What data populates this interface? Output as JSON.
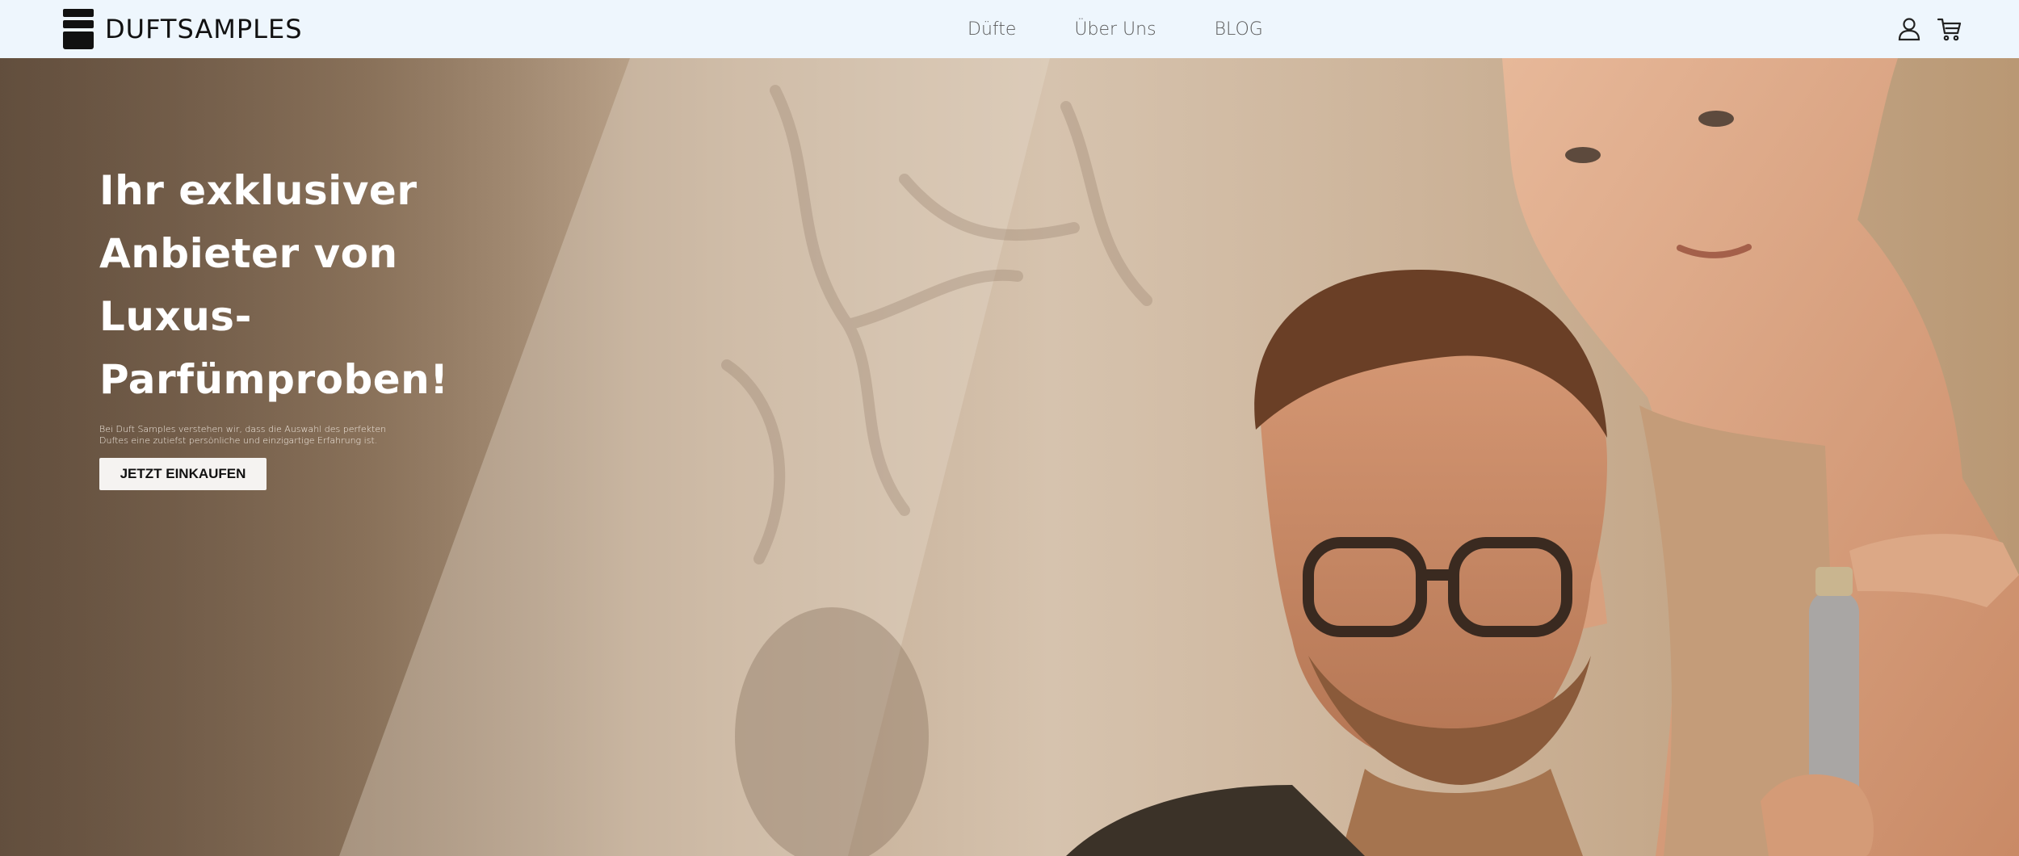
{
  "header": {
    "logo_text": "DUFTSAMPLES",
    "logo_icon": "stacked-bars-logo",
    "nav": [
      {
        "label": "Düfte"
      },
      {
        "label": "Über Uns"
      },
      {
        "label": "BLOG"
      }
    ],
    "icons": [
      "user-icon",
      "cart-icon"
    ]
  },
  "hero": {
    "title_line_1": "Ihr exklusiver",
    "title_line_2": "Anbieter von",
    "title_line_3": "Luxus-",
    "title_line_4": "Parfümproben!",
    "text_line_1": "Bei Duft Samples verstehen wir, dass die Auswahl des perfekten",
    "text_line_2": "Duftes eine zutiefst persönliche und einzigartige Erfahrung ist.",
    "button_label": "JETZT EINKAUFEN",
    "image": "hero-photo"
  },
  "colors": {
    "header_bg": "#eef6fd",
    "hero_title": "#ffffff",
    "button_bg": "#f5f3f1",
    "button_text": "#111111"
  }
}
